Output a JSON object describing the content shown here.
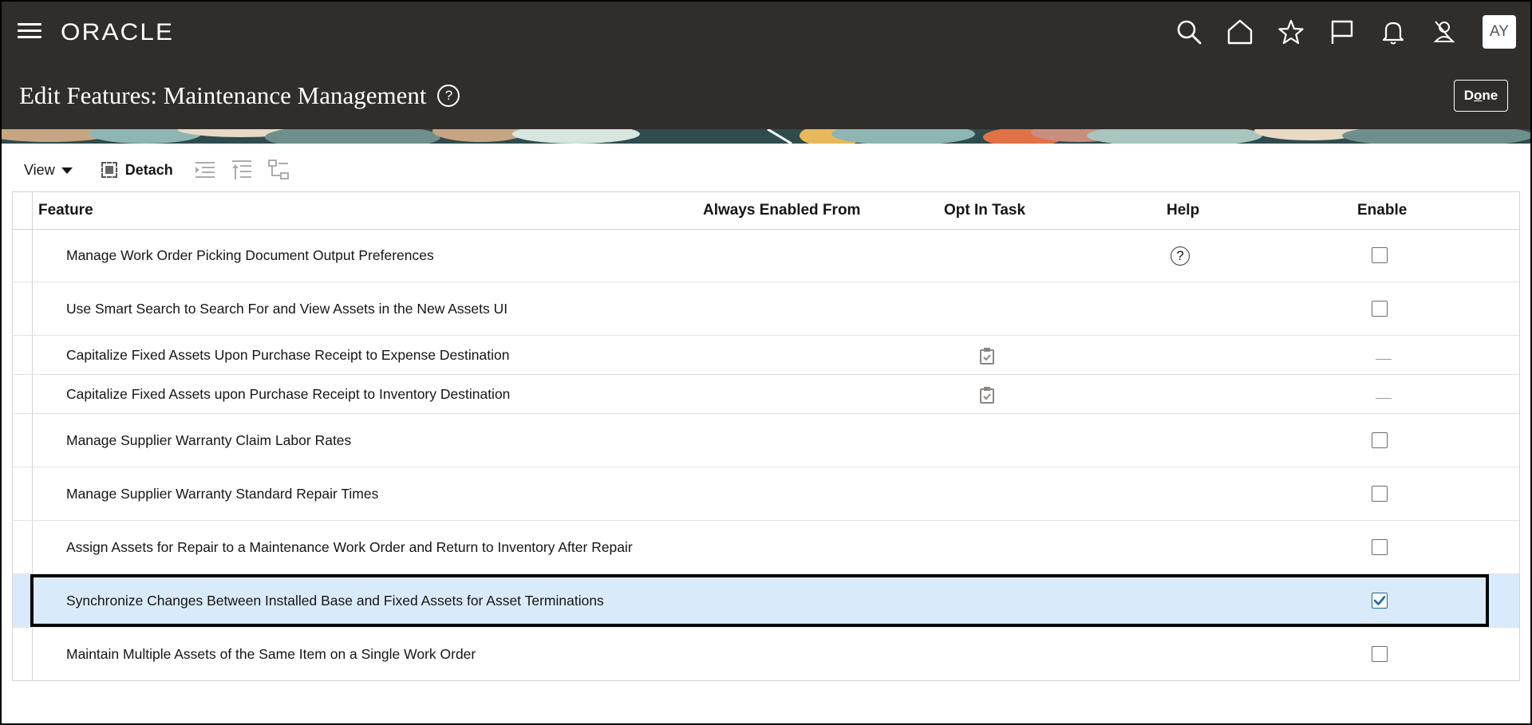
{
  "header": {
    "logo": "ORACLE",
    "page_title": "Edit Features: Maintenance Management",
    "help_glyph": "?",
    "done_label_prefix": "D",
    "done_label_underlined": "o",
    "done_label_suffix": "ne",
    "avatar_initials": "AY",
    "icons": [
      "menu-icon",
      "search-icon",
      "home-icon",
      "star-icon",
      "flag-icon",
      "bell-icon",
      "user-icon"
    ]
  },
  "toolbar": {
    "view_label": "View",
    "detach_label": "Detach"
  },
  "table": {
    "columns": {
      "feature": "Feature",
      "always_enabled_from": "Always Enabled From",
      "opt_in_task": "Opt In Task",
      "help": "Help",
      "enable": "Enable"
    },
    "rows": [
      {
        "feature": "Manage Work Order Picking Document Output Preferences",
        "has_help": true,
        "has_task": false,
        "enable": "unchecked"
      },
      {
        "feature": "Use Smart Search to Search For and View Assets in the New Assets UI",
        "has_help": false,
        "has_task": false,
        "enable": "unchecked"
      },
      {
        "feature": "Capitalize Fixed Assets Upon Purchase Receipt to Expense Destination",
        "has_help": false,
        "has_task": true,
        "enable": "none"
      },
      {
        "feature": "Capitalize Fixed Assets upon Purchase Receipt to Inventory Destination",
        "has_help": false,
        "has_task": true,
        "enable": "none"
      },
      {
        "feature": "Manage Supplier Warranty Claim Labor Rates",
        "has_help": false,
        "has_task": false,
        "enable": "unchecked"
      },
      {
        "feature": "Manage Supplier Warranty Standard Repair Times",
        "has_help": false,
        "has_task": false,
        "enable": "unchecked"
      },
      {
        "feature": "Assign Assets for Repair to a Maintenance Work Order and Return to Inventory After Repair",
        "has_help": false,
        "has_task": false,
        "enable": "unchecked"
      },
      {
        "feature": "Synchronize Changes Between Installed Base and Fixed Assets for Asset Terminations",
        "has_help": false,
        "has_task": false,
        "enable": "checked",
        "selected": true
      },
      {
        "feature": "Maintain Multiple Assets of the Same Item on a Single Work Order",
        "has_help": false,
        "has_task": false,
        "enable": "unchecked"
      }
    ]
  },
  "colors": {
    "header_bg": "#312d2a",
    "selected_row": "#d9ebfa",
    "checkbox_accent": "#1c63a6"
  }
}
